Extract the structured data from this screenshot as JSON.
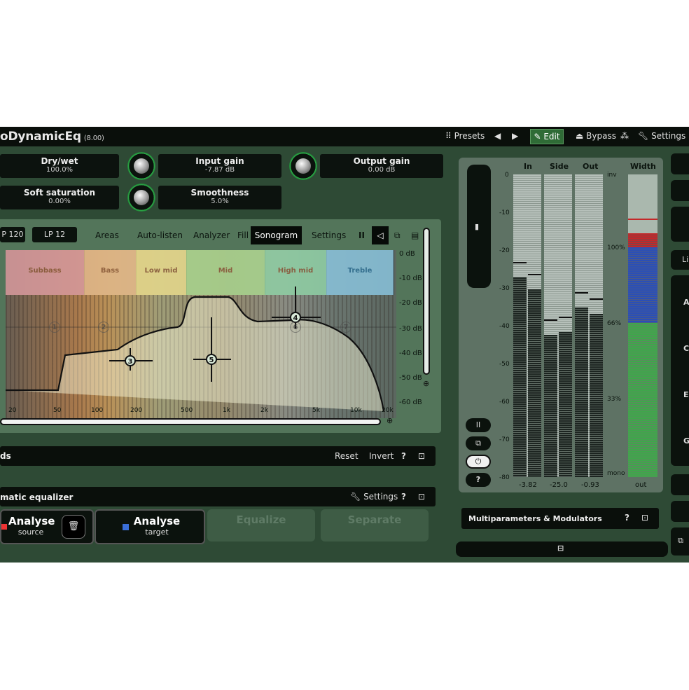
{
  "titlebar": {
    "title": "oDynamicEq",
    "version": "(8.00)",
    "presets": "Presets",
    "prev": "◀",
    "next": "▶",
    "edit": "Edit",
    "bypass": "Bypass",
    "settings": "Settings"
  },
  "params": {
    "drywet": {
      "name": "Dry/wet",
      "value": "100.0%"
    },
    "input_gain": {
      "name": "Input gain",
      "value": "-7.87 dB"
    },
    "output_gain": {
      "name": "Output gain",
      "value": "0.00 dB"
    },
    "soft_saturation": {
      "name": "Soft saturation",
      "value": "0.00%"
    },
    "smoothness": {
      "name": "Smoothness",
      "value": "5.0%"
    }
  },
  "eq_toolbar": {
    "hp": "P 120",
    "lp": "LP 12",
    "areas": "Areas",
    "autolisten": "Auto-listen",
    "analyzer": "Analyzer",
    "fill": "Fill",
    "sonogram": "Sonogram",
    "settings": "Settings"
  },
  "bands": [
    "Subbass",
    "Bass",
    "Low mid",
    "Mid",
    "High mid",
    "Treble"
  ],
  "band_colors": [
    "#d89a9e",
    "#e2b98b",
    "#e6d98c",
    "#a8d48e",
    "#8fd0a5",
    "#89c3dc"
  ],
  "db_labels": [
    "0 dB",
    "-10 dB",
    "-20 dB",
    "-30 dB",
    "-40 dB",
    "-50 dB",
    "-60 dB"
  ],
  "freq_labels": [
    "20",
    "50",
    "100",
    "200",
    "500",
    "1k",
    "2k",
    "5k",
    "10k",
    "20k"
  ],
  "eq_nodes": [
    "1",
    "2",
    "3",
    "4",
    "5",
    "6",
    "7"
  ],
  "bands_section": {
    "title": "ds",
    "reset": "Reset",
    "invert": "Invert",
    "help": "?"
  },
  "auto_eq": {
    "title": "matic equalizer",
    "settings": "Settings",
    "help": "?",
    "analyse_source": {
      "title": "Analyse",
      "sub": "source"
    },
    "analyse_target": {
      "title": "Analyse",
      "sub": "target"
    },
    "equalize": "Equalize",
    "separate": "Separate"
  },
  "meter": {
    "headers": {
      "in": "In",
      "side": "Side",
      "out": "Out",
      "width": "Width"
    },
    "scale": [
      "0",
      "-10",
      "-20",
      "-30",
      "-40",
      "-50",
      "-60",
      "-70",
      "-80"
    ],
    "width_scale": [
      "inv",
      "100%",
      "66%",
      "33%",
      "mono"
    ],
    "values": {
      "in": "-3.82",
      "side": "-25.0",
      "out": "-0.93",
      "width": "out"
    },
    "levels": {
      "in_l": 0.66,
      "in_r": 0.62,
      "side_l": 0.47,
      "side_r": 0.48,
      "out_l": 0.56,
      "out_r": 0.54
    }
  },
  "side_buttons": {
    "pause": "II",
    "help": "?"
  },
  "multiparams": {
    "title": "Multiparameters & Modulators",
    "help": "?"
  },
  "right_letters": [
    "Li",
    "A",
    "C",
    "E",
    "G"
  ],
  "colors": {
    "accent_green": "#2f6b36",
    "panel_dark": "#0a0f0b"
  }
}
